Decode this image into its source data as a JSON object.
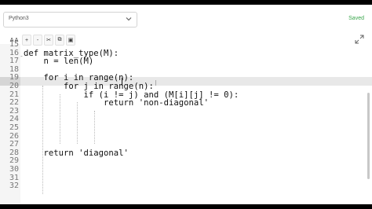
{
  "header": {
    "language": "Python3",
    "status": "Saved"
  },
  "toolbar": {
    "font_size_label": "A A",
    "zoom_in_label": "+",
    "zoom_out_label": "-",
    "cut_label": "✂",
    "copy_label": "⧉",
    "save_label": "▣"
  },
  "editor": {
    "lines": [
      {
        "num": "15",
        "text": ""
      },
      {
        "num": "16",
        "text": "def matrix_type(M):"
      },
      {
        "num": "17",
        "text": "    n = len(M)"
      },
      {
        "num": "18",
        "text": ""
      },
      {
        "num": "19",
        "text": "    for i in range(n):"
      },
      {
        "num": "20",
        "text": "        for j in range(n):"
      },
      {
        "num": "21",
        "text": "            if (i != j) and (M[i][j] != 0):"
      },
      {
        "num": "22",
        "text": "                return 'non-diagonal'"
      },
      {
        "num": "23",
        "text": ""
      },
      {
        "num": "24",
        "text": ""
      },
      {
        "num": "25",
        "text": ""
      },
      {
        "num": "26",
        "text": ""
      },
      {
        "num": "27",
        "text": ""
      },
      {
        "num": "28",
        "text": "    return 'diagonal'"
      },
      {
        "num": "29",
        "text": ""
      },
      {
        "num": "30",
        "text": ""
      },
      {
        "num": "31",
        "text": ""
      },
      {
        "num": "32",
        "text": ""
      }
    ]
  },
  "icons": [
    "chevron-down-icon",
    "font-size-icon",
    "zoom-in-icon",
    "zoom-out-icon",
    "cut-icon",
    "copy-icon",
    "save-icon",
    "expand-icon"
  ]
}
